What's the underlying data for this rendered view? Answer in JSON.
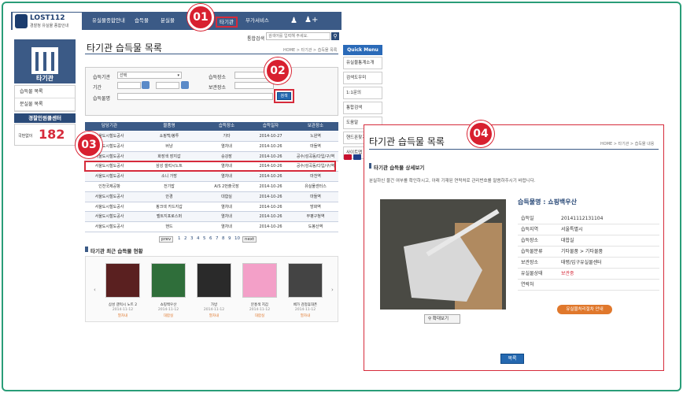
{
  "logo": {
    "title": "LOST112",
    "subtitle": "경찰청 유실물 종합안내"
  },
  "nav": {
    "items": [
      "유실물종합안내",
      "습득물",
      "분실물",
      "타기관",
      "부가서비스"
    ]
  },
  "search": {
    "label": "통합검색",
    "placeholder": "검색어를 입력해 주세요."
  },
  "sidebar": {
    "title": "타기관",
    "items": [
      "습득물 목록",
      "분실물 목록"
    ],
    "center_title": "경찰민원콜센터",
    "call_label": "국번없이",
    "call_number": "182"
  },
  "page": {
    "title": "타기관 습득물 목록",
    "breadcrumb": "HOME > 타기관 > 습득물 목록"
  },
  "form": {
    "agency_label": "습득기관",
    "agency_value": "선택",
    "place_label": "습득장소",
    "period_label": "기간",
    "storage_label": "보관장소",
    "item_label": "습득물명",
    "search_button": "검색"
  },
  "table": {
    "headers": [
      "담당기관",
      "물품명",
      "습득장소",
      "습득일자",
      "보관장소"
    ],
    "rows": [
      [
        "서울도시철도공사",
        "쇼핑백/봉투",
        "기타",
        "2014-10-27",
        "노원역"
      ],
      [
        "서울도시철도공사",
        "버냥",
        "열차내",
        "2014-10-26",
        "마들역"
      ],
      [
        "서울도시철도공사",
        "화장색 장지갑",
        "승강장",
        "2014-10-26",
        "공수/성곡동/다입/구/역"
      ],
      [
        "서울도시철도공사",
        "삼성 갤럭시노트",
        "열차내",
        "2014-10-26",
        "공수/성곡동/다입/구/역"
      ],
      [
        "서울도시철도공사",
        "소니 가방",
        "열차내",
        "2014-10-26",
        "마천역"
      ],
      [
        "인천국제공항",
        "전기밥",
        "A/S 2번출국장",
        "2014-10-26",
        "유실물센터스"
      ],
      [
        "서울도시철도공사",
        "안경",
        "대합실",
        "2014-10-26",
        "마들역"
      ],
      [
        "서울도시철도공사",
        "핑크색 카드지갑",
        "열차내",
        "2014-10-26",
        "방화역"
      ],
      [
        "서울도시철도공사",
        "벨트지포로스퍼",
        "열차내",
        "2014-10-26",
        "부평구청역"
      ],
      [
        "서울도시철도공사",
        "핸드",
        "열차내",
        "2014-10-26",
        "도봉산역"
      ]
    ]
  },
  "pagination": {
    "prev": "prev",
    "pages": [
      "1",
      "2",
      "3",
      "4",
      "5",
      "6",
      "7",
      "8",
      "9",
      "10"
    ],
    "next": "next"
  },
  "recent": {
    "title": "타기관 최근 습득물 현황",
    "items": [
      {
        "name": "삼성 갤럭시 노트 2",
        "date": "2014-11-12",
        "place": "열차내"
      },
      {
        "name": "쇼핑백우산",
        "date": "2014-11-12",
        "place": "대합실"
      },
      {
        "name": "가방",
        "date": "2014-11-12",
        "place": "열차내"
      },
      {
        "name": "분홍색 지갑",
        "date": "2014-11-12",
        "place": "대합실"
      },
      {
        "name": "베가 검정휴대폰",
        "date": "2014-11-12",
        "place": "열차내"
      }
    ]
  },
  "quickmenu": {
    "title": "Quick Menu",
    "items": [
      "유실물통계소개",
      "검색도우미",
      "1:1문의",
      "통합검색",
      "도움말",
      "핸드폰찾기",
      "사이트맵"
    ]
  },
  "detail": {
    "title": "타기관 습득물 목록",
    "breadcrumb": "HOME > 타기관 > 습득물 내용",
    "section": "타기관 습득물 상세보기",
    "note": "분실하신 물건 여부를 확인하시고, 아래 기재된 연락처로 관리번호를 말씀하주시기 바랍니다.",
    "item_title": "습득물명 : 쇼핑백우산",
    "fields": [
      {
        "k": "습득일",
        "v": "20141112131104"
      },
      {
        "k": "습득지역",
        "v": "서울특별시"
      },
      {
        "k": "습득장소",
        "v": "대합실"
      },
      {
        "k": "습득물분류",
        "v": "기타물품 > 기타물품"
      },
      {
        "k": "보관장소",
        "v": "태평/입구유실물센터"
      },
      {
        "k": "유실물상태",
        "v": "보관중"
      },
      {
        "k": "연락처",
        "v": ""
      }
    ],
    "guide_button": "유실물처리절차 안내",
    "zoom_button": "확대보기",
    "list_button": "목록"
  },
  "callouts": [
    "01",
    "02",
    "03",
    "04"
  ],
  "colors": {
    "nav_bg": "#3b5a86",
    "highlight": "#d62b3b",
    "frame": "#2a9d78",
    "accent": "#e0782c"
  }
}
